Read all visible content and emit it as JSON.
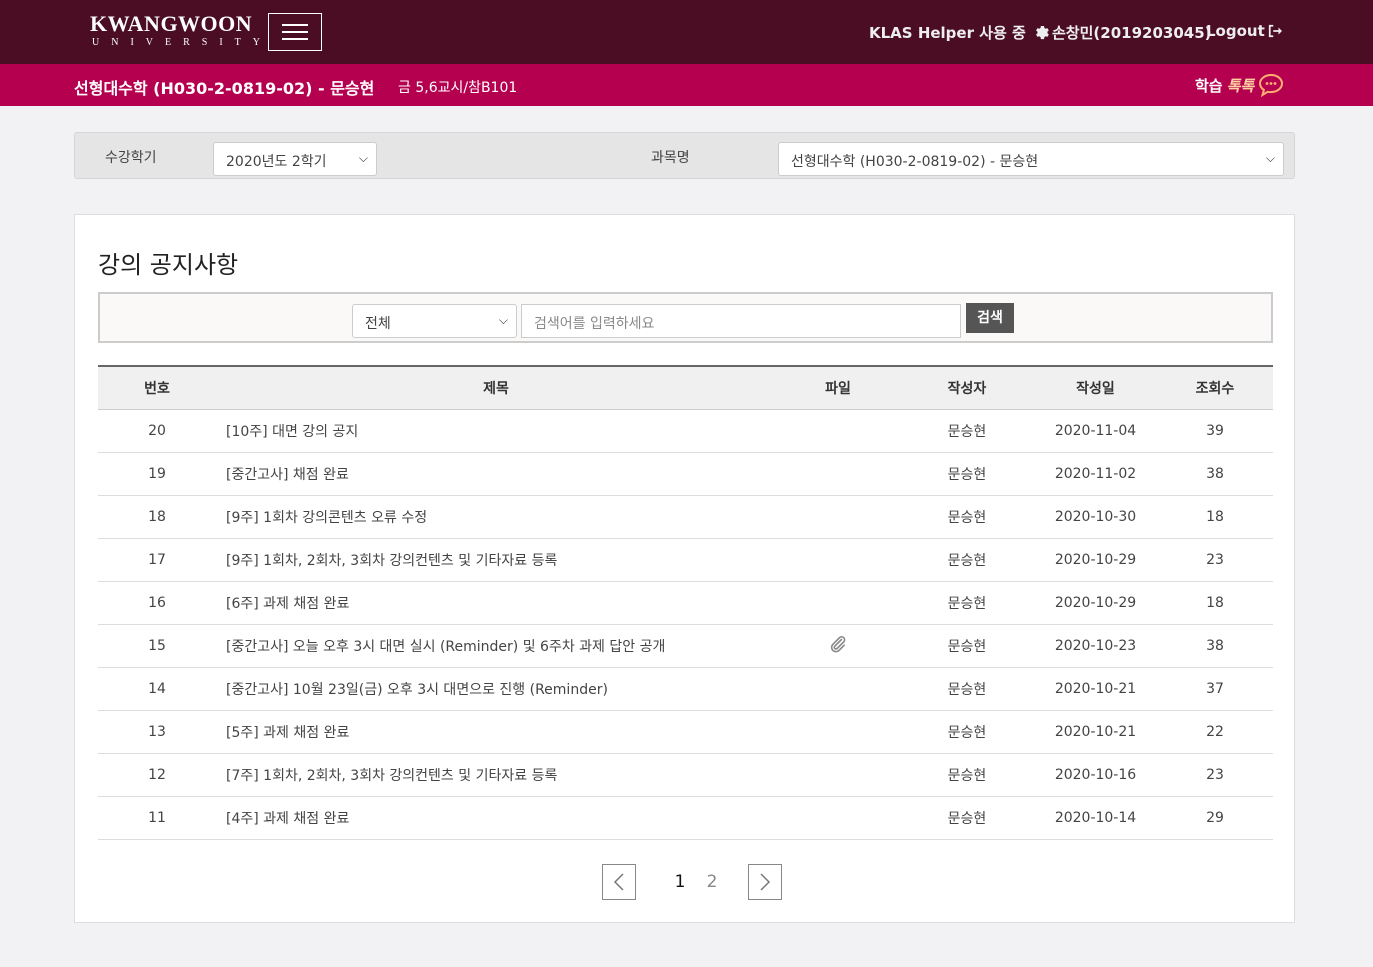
{
  "header": {
    "logo_main": "KWANGWOON",
    "logo_sub": "UNIVERSITY",
    "helper_text": "KLAS Helper 사용 중",
    "user_name": "손창민(2019203045)",
    "logout_label": "Logout"
  },
  "subheader": {
    "course_title": "선형대수학 (H030-2-0819-02) - 문승현",
    "class_time": "금 5,6교시/참B101",
    "talk_label_1": "학습",
    "talk_label_2": "톡톡"
  },
  "filter": {
    "semester_label": "수강학기",
    "semester_value": "2020년도 2학기",
    "subject_label": "과목명",
    "subject_value": "선형대수학 (H030-2-0819-02) - 문승현"
  },
  "board": {
    "title": "강의 공지사항",
    "search_category": "전체",
    "search_placeholder": "검색어를 입력하세요",
    "search_button": "검색",
    "columns": [
      "번호",
      "제목",
      "파일",
      "작성자",
      "작성일",
      "조회수"
    ],
    "rows": [
      {
        "no": "20",
        "title": "[10주] 대면 강의 공지",
        "file": false,
        "author": "문승현",
        "date": "2020-11-04",
        "views": "39"
      },
      {
        "no": "19",
        "title": "[중간고사] 채점 완료",
        "file": false,
        "author": "문승현",
        "date": "2020-11-02",
        "views": "38"
      },
      {
        "no": "18",
        "title": "[9주] 1회차 강의콘텐츠 오류 수정",
        "file": false,
        "author": "문승현",
        "date": "2020-10-30",
        "views": "18"
      },
      {
        "no": "17",
        "title": "[9주] 1회차, 2회차, 3회차 강의컨텐츠 및 기타자료 등록",
        "file": false,
        "author": "문승현",
        "date": "2020-10-29",
        "views": "23"
      },
      {
        "no": "16",
        "title": "[6주] 과제 채점 완료",
        "file": false,
        "author": "문승현",
        "date": "2020-10-29",
        "views": "18"
      },
      {
        "no": "15",
        "title": "[중간고사] 오늘 오후 3시 대면 실시 (Reminder) 및 6주차 과제 답안 공개",
        "file": true,
        "author": "문승현",
        "date": "2020-10-23",
        "views": "38"
      },
      {
        "no": "14",
        "title": "[중간고사] 10월 23일(금) 오후 3시 대면으로 진행 (Reminder)",
        "file": false,
        "author": "문승현",
        "date": "2020-10-21",
        "views": "37"
      },
      {
        "no": "13",
        "title": "[5주] 과제 채점 완료",
        "file": false,
        "author": "문승현",
        "date": "2020-10-21",
        "views": "22"
      },
      {
        "no": "12",
        "title": "[7주] 1회차, 2회차, 3회차 강의컨텐츠 및 기타자료 등록",
        "file": false,
        "author": "문승현",
        "date": "2020-10-16",
        "views": "23"
      },
      {
        "no": "11",
        "title": "[4주] 과제 채점 완료",
        "file": false,
        "author": "문승현",
        "date": "2020-10-14",
        "views": "29"
      }
    ]
  },
  "pagination": {
    "pages": [
      "1",
      "2"
    ],
    "current": "1"
  },
  "icons": {
    "menu": "hamburger-icon",
    "settings": "gear-icon",
    "logout": "logout-icon",
    "talk": "chat-bubble-icon",
    "attachment": "paperclip-icon",
    "prev": "chevron-left-icon",
    "next": "chevron-right-icon"
  },
  "colors": {
    "topbar": "#4a0d24",
    "subbar": "#b5004f"
  }
}
